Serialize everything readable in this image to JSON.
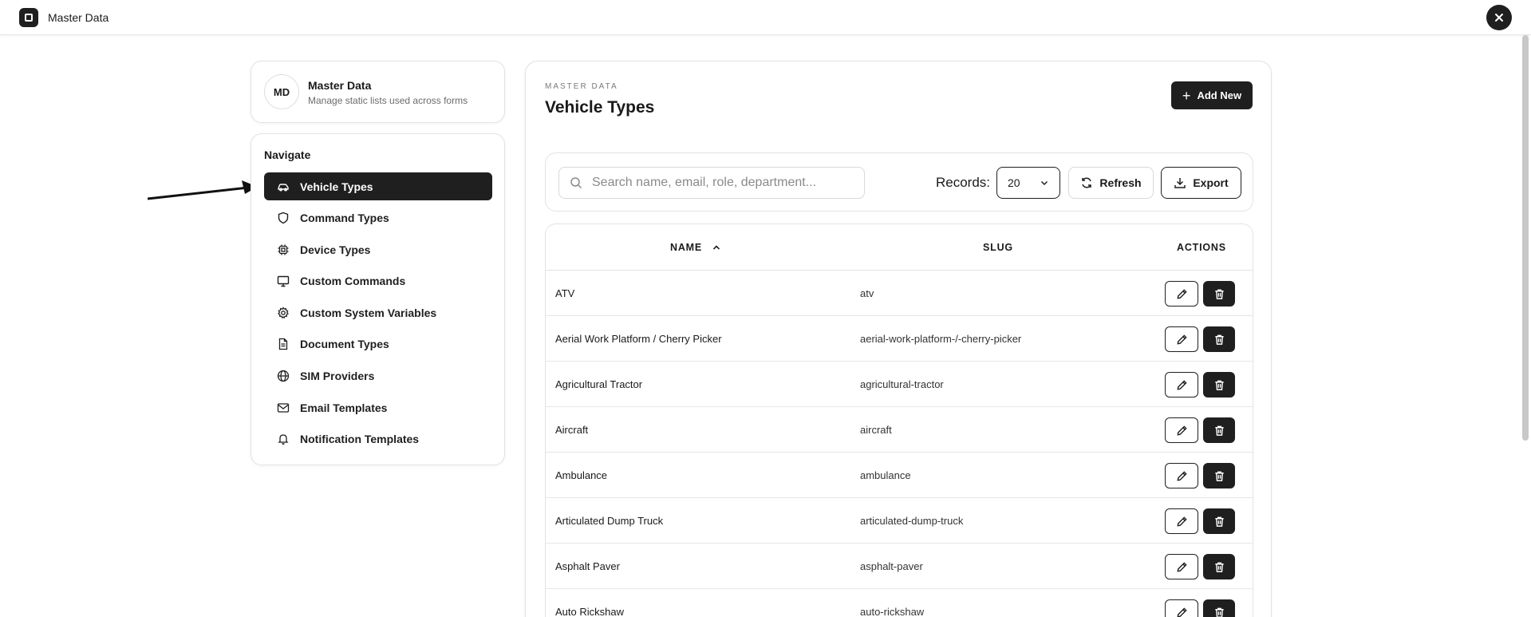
{
  "app": {
    "title": "Master Data"
  },
  "profile": {
    "initials": "MD",
    "title": "Master Data",
    "subtitle": "Manage static lists used across forms"
  },
  "nav": {
    "heading": "Navigate",
    "items": [
      {
        "label": "Vehicle Types",
        "icon": "car-icon",
        "active": true
      },
      {
        "label": "Command Types",
        "icon": "shield-icon"
      },
      {
        "label": "Device Types",
        "icon": "chip-icon"
      },
      {
        "label": "Custom Commands",
        "icon": "monitor-icon"
      },
      {
        "label": "Custom System Variables",
        "icon": "gear-icon"
      },
      {
        "label": "Document Types",
        "icon": "document-icon"
      },
      {
        "label": "SIM Providers",
        "icon": "globe-icon"
      },
      {
        "label": "Email Templates",
        "icon": "mail-icon"
      },
      {
        "label": "Notification Templates",
        "icon": "bell-icon"
      }
    ]
  },
  "main": {
    "overline": "MASTER DATA",
    "title": "Vehicle Types",
    "add_label": "Add New"
  },
  "toolbar": {
    "search_placeholder": "Search name, email, role, department...",
    "records_label": "Records:",
    "records_value": "20",
    "refresh_label": "Refresh",
    "export_label": "Export"
  },
  "table": {
    "columns": {
      "name": "NAME",
      "slug": "SLUG",
      "actions": "ACTIONS"
    },
    "sort": {
      "column": "name",
      "direction": "ascending"
    },
    "rows": [
      {
        "name": "ATV",
        "slug": "atv"
      },
      {
        "name": "Aerial Work Platform / Cherry Picker",
        "slug": "aerial-work-platform-/-cherry-picker"
      },
      {
        "name": "Agricultural Tractor",
        "slug": "agricultural-tractor"
      },
      {
        "name": "Aircraft",
        "slug": "aircraft"
      },
      {
        "name": "Ambulance",
        "slug": "ambulance"
      },
      {
        "name": "Articulated Dump Truck",
        "slug": "articulated-dump-truck"
      },
      {
        "name": "Asphalt Paver",
        "slug": "asphalt-paver"
      },
      {
        "name": "Auto Rickshaw",
        "slug": "auto-rickshaw"
      }
    ]
  },
  "colors": {
    "primary": "#1f1f1f",
    "border": "#e3e3e3",
    "muted": "#6b6b6b"
  }
}
